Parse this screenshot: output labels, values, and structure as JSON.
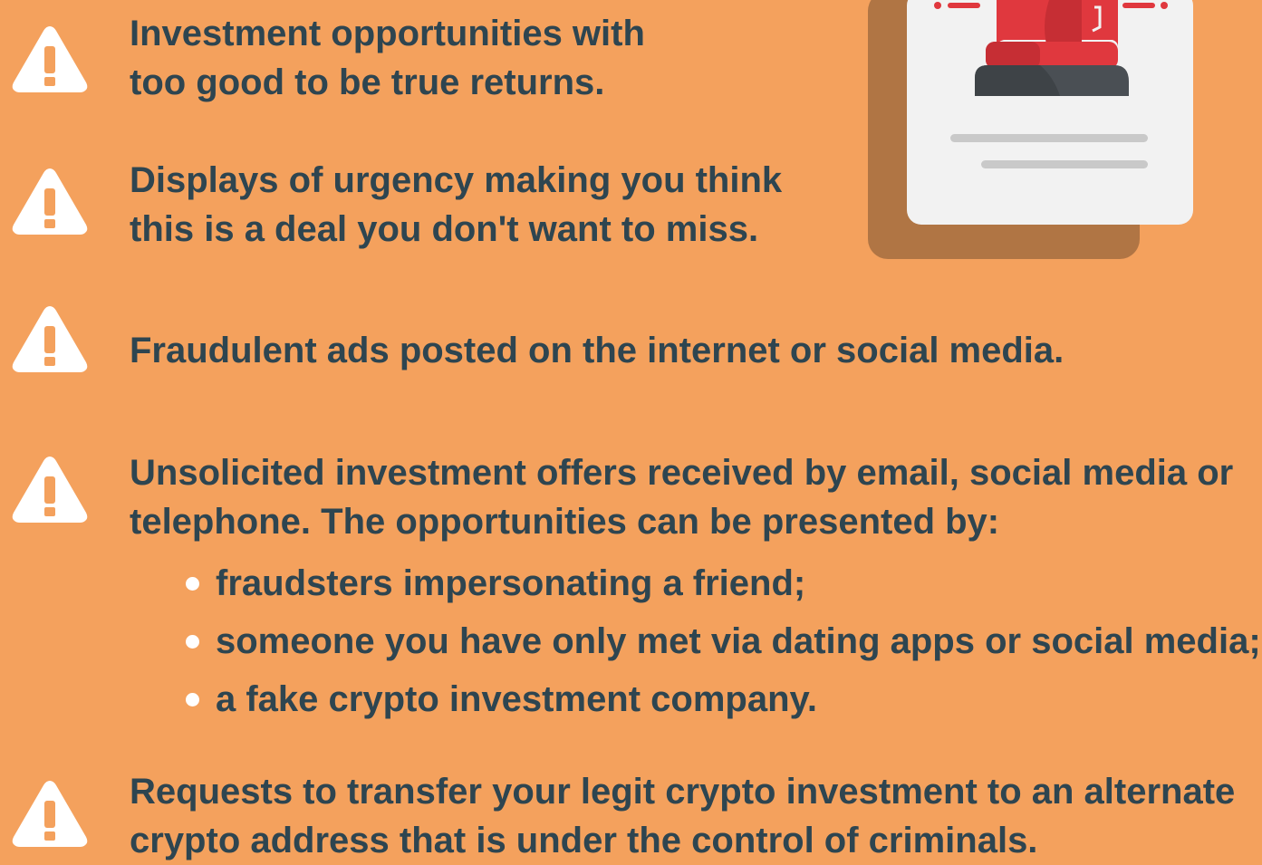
{
  "items": [
    {
      "icon": "warning-triangle-icon",
      "lines": [
        "Investment opportunities with",
        "too good to be true returns."
      ]
    },
    {
      "icon": "warning-triangle-icon",
      "lines": [
        "Displays of urgency making you think",
        "this is a deal you don't want to miss."
      ]
    },
    {
      "icon": "warning-triangle-icon",
      "lines": [
        "Fraudulent ads posted on the internet or social media."
      ]
    },
    {
      "icon": "warning-triangle-icon",
      "lines": [
        "Unsolicited investment offers received by email, social media or",
        "telephone. The opportunities can be presented by:"
      ],
      "bullets": [
        "fraudsters impersonating a friend;",
        "someone you have only met via dating apps or social media;",
        "a fake crypto investment company."
      ]
    },
    {
      "icon": "warning-triangle-icon",
      "lines": [
        "Requests to transfer your legit crypto investment to an alternate",
        "crypto address that is under the control of criminals."
      ]
    }
  ],
  "illustration": {
    "icon": "alarm-siren-document-icon"
  },
  "colors": {
    "background": "#F4A15D",
    "text": "#2E4550",
    "icon": "#FFFFFF",
    "siren_red": "#E0383E",
    "siren_base": "#4A4F54",
    "paper": "#F2F2F2",
    "paper_shadow": "#B07544"
  }
}
